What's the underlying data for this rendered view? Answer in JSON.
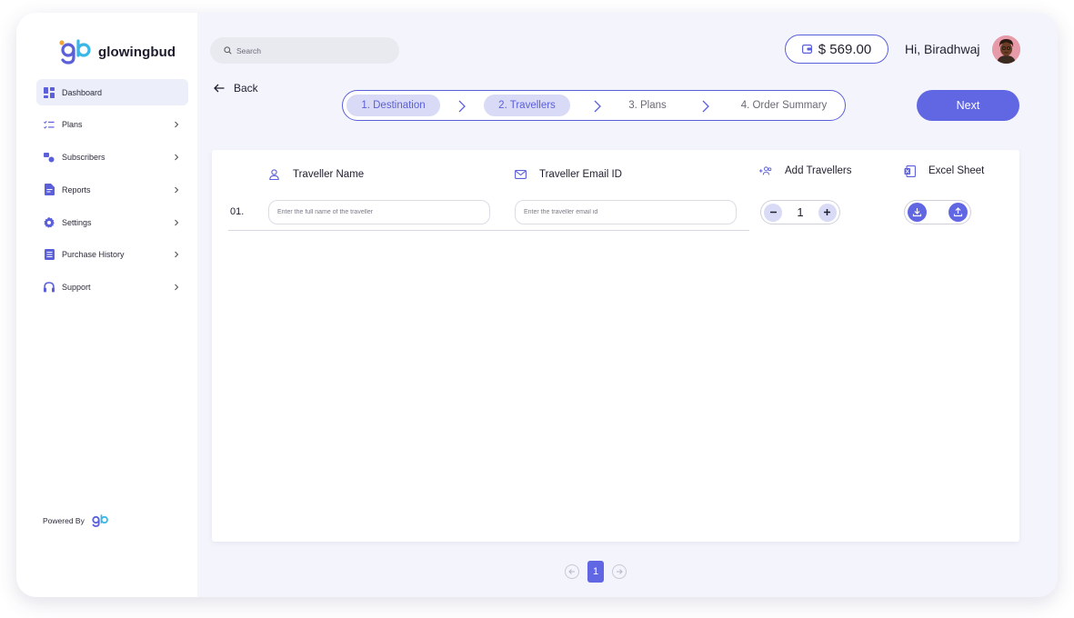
{
  "brand": {
    "name": "glowingbud",
    "accent": "#6166e3",
    "logo_colors": [
      "#5b5fd9",
      "#3ab7e6",
      "#f2a33a"
    ]
  },
  "sidebar": {
    "items": [
      {
        "label": "Dashboard",
        "icon": "dashboard-icon",
        "active": true
      },
      {
        "label": "Plans",
        "icon": "plans-list-icon"
      },
      {
        "label": "Subscribers",
        "icon": "subscribers-icon"
      },
      {
        "label": "Reports",
        "icon": "reports-icon"
      },
      {
        "label": "Settings",
        "icon": "settings-gear-icon"
      },
      {
        "label": "Purchase History",
        "icon": "purchase-history-icon"
      },
      {
        "label": "Support",
        "icon": "headphones-icon"
      }
    ],
    "powered_by": "Powered By"
  },
  "header": {
    "search_placeholder": "Search",
    "wallet_amount": "$ 569.00",
    "greeting": "Hi, Biradhwaj"
  },
  "nav": {
    "back_label": "Back",
    "next_label": "Next"
  },
  "stepper": {
    "steps": [
      {
        "label": "1.  Destination",
        "state": "done"
      },
      {
        "label": "2.  Travellers",
        "state": "done"
      },
      {
        "label": "3.  Plans",
        "state": "pending"
      },
      {
        "label": "4.  Order Summary",
        "state": "pending"
      }
    ]
  },
  "travellers": {
    "columns": {
      "name": "Traveller Name",
      "email": "Traveller Email ID",
      "add": "Add Travellers",
      "excel": "Excel Sheet"
    },
    "rows": [
      {
        "number": "01.",
        "name_placeholder": "Enter the full name of the traveller",
        "email_placeholder": "Enter the traveller email id"
      }
    ],
    "quantity": "1"
  },
  "pagination": {
    "current": "1"
  }
}
